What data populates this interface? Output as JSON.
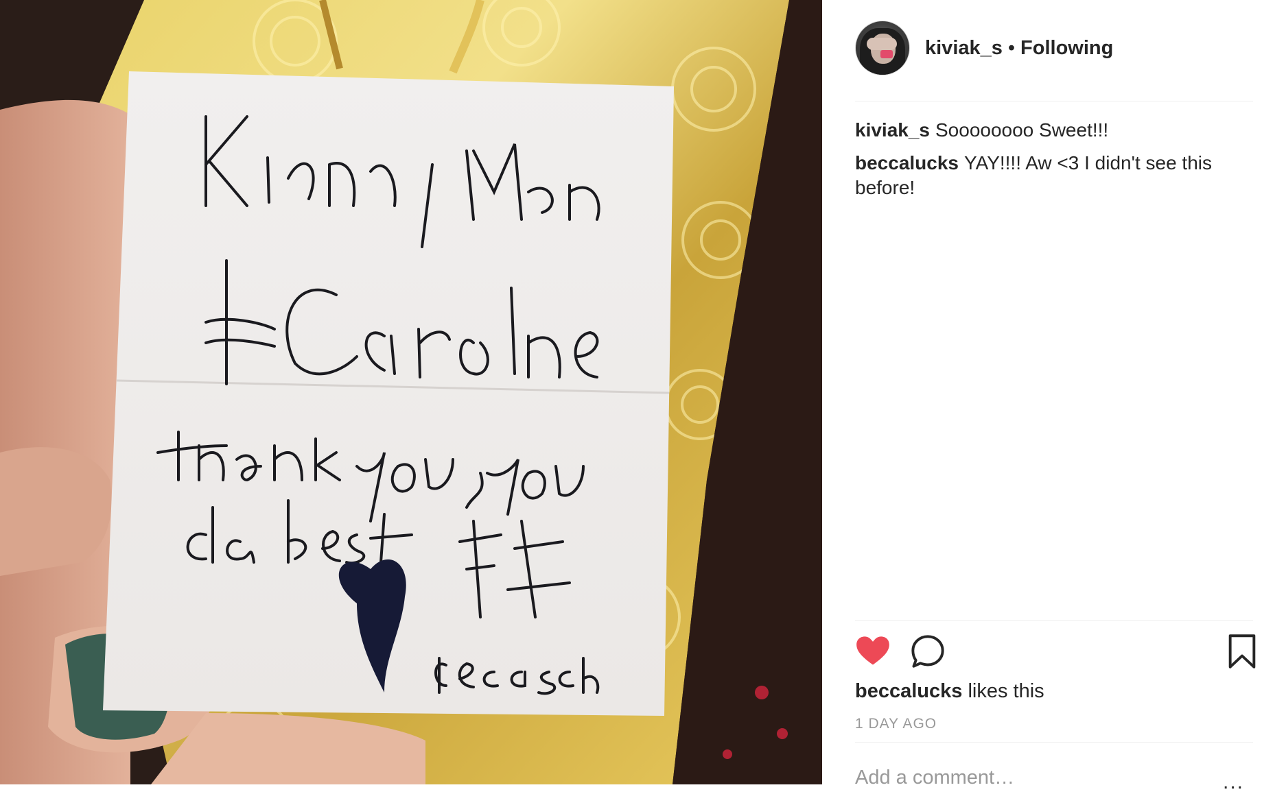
{
  "photo": {
    "alt_icon": "handwritten-thank-you-note",
    "note_lines": [
      "Kiana, Mona",
      "& Caroline",
      "thank you, you",
      "da best",
      "谢谢",
      "Becca, Sochi"
    ]
  },
  "post": {
    "username": "kiviak_s",
    "separator": "•",
    "follow_status": "Following"
  },
  "comments": [
    {
      "author": "kiviak_s",
      "text": "Soooooooo Sweet!!!"
    },
    {
      "author": "beccalucks",
      "text": "YAY!!!! Aw <3 I didn't see this before!"
    }
  ],
  "actions": {
    "like_icon": "heart-filled-icon",
    "comment_icon": "comment-bubble-icon",
    "save_icon": "bookmark-icon",
    "like_color": "#ed4956"
  },
  "likes": {
    "who": "beccalucks",
    "suffix": "likes this"
  },
  "timestamp": "1 DAY AGO",
  "add_comment": {
    "placeholder": "Add a comment…"
  },
  "more": "..."
}
